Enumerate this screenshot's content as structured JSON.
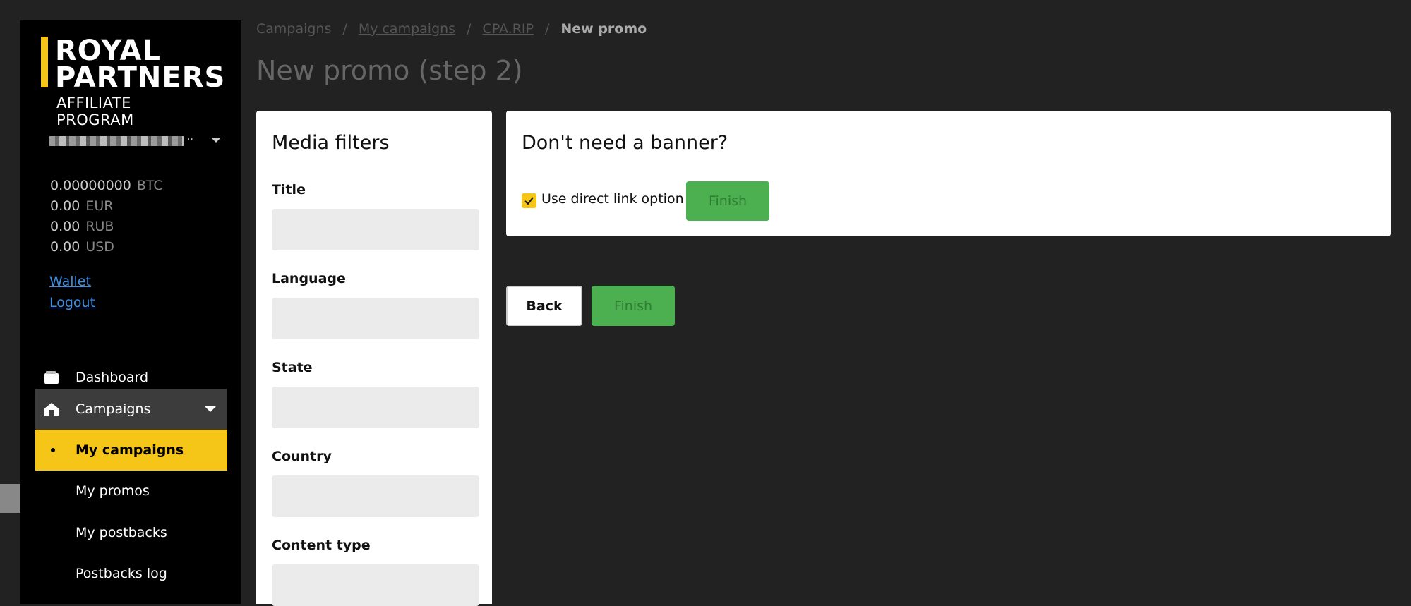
{
  "sidebar": {
    "logo": {
      "line1": "ROYAL",
      "line2": "PARTNERS",
      "line3": "AFFILIATE PROGRAM"
    },
    "user": {
      "name_dots": ".."
    },
    "balances": [
      {
        "amount": "0.00000000",
        "currency": "BTC"
      },
      {
        "amount": "0.00",
        "currency": "EUR"
      },
      {
        "amount": "0.00",
        "currency": "RUB"
      },
      {
        "amount": "0.00",
        "currency": "USD"
      }
    ],
    "links": {
      "wallet": "Wallet",
      "logout": "Logout"
    },
    "nav": {
      "dashboard": "Dashboard",
      "campaigns": "Campaigns",
      "my_campaigns": "My campaigns",
      "my_promos": "My promos",
      "my_postbacks": "My postbacks",
      "postbacks_log": "Postbacks log"
    },
    "icons": {
      "dashboard": "wallet-icon",
      "campaigns": "home-icon",
      "expand": "caret-down-icon"
    }
  },
  "breadcrumb": {
    "items": [
      "Campaigns",
      "My campaigns",
      "CPA.RIP",
      "New promo"
    ],
    "separator": "/"
  },
  "page": {
    "title": "New promo (step 2)"
  },
  "filters": {
    "title": "Media filters",
    "fields": [
      {
        "label": "Title",
        "value": ""
      },
      {
        "label": "Language",
        "value": ""
      },
      {
        "label": "State",
        "value": ""
      },
      {
        "label": "Country",
        "value": ""
      },
      {
        "label": "Content type",
        "value": ""
      }
    ]
  },
  "banner_panel": {
    "title": "Don't need a banner?",
    "checkbox_label": "Use direct link option",
    "checkbox_checked": true,
    "finish_label": "Finish"
  },
  "actions": {
    "back_label": "Back",
    "finish_label": "Finish"
  },
  "colors": {
    "accent_yellow": "#f5c518",
    "finish_green": "#4caf50",
    "link_blue": "#3a8ee6",
    "page_bg": "#222222",
    "sidebar_bg": "#000000"
  }
}
